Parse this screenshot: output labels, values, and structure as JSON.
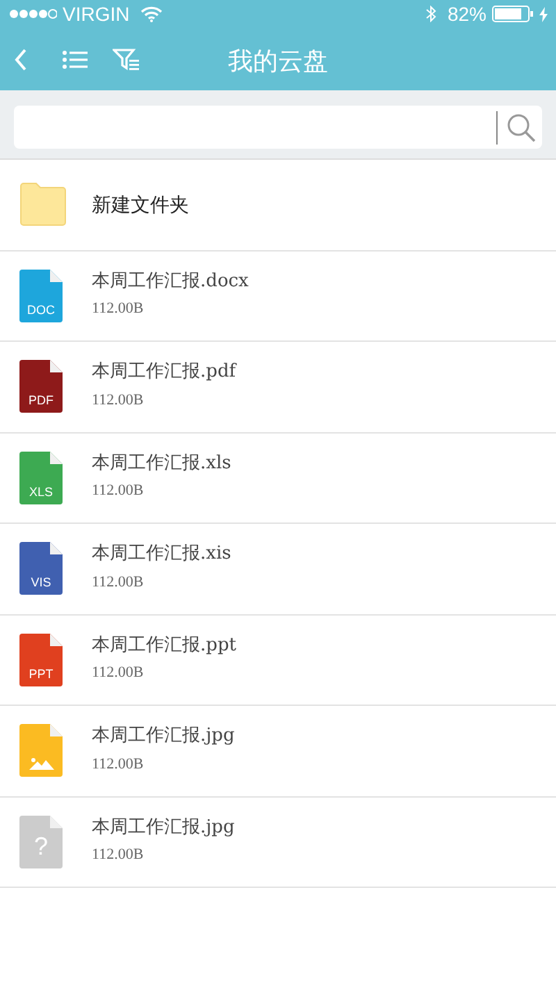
{
  "status_bar": {
    "carrier": "VIRGIN",
    "battery": "82%"
  },
  "header": {
    "title": "我的云盘"
  },
  "items": [
    {
      "kind": "folder",
      "name": "新建文件夹"
    },
    {
      "kind": "doc",
      "name": "本周工作汇报.docx",
      "size": "112.00B",
      "label": "DOC",
      "color": "#1ea6dc"
    },
    {
      "kind": "doc",
      "name": "本周工作汇报.pdf",
      "size": "112.00B",
      "label": "PDF",
      "color": "#8e1a1a"
    },
    {
      "kind": "doc",
      "name": "本周工作汇报.xls",
      "size": "112.00B",
      "label": "XLS",
      "color": "#3daa52"
    },
    {
      "kind": "doc",
      "name": "本周工作汇报.xis",
      "size": "112.00B",
      "label": "VIS",
      "color": "#4060b0"
    },
    {
      "kind": "doc",
      "name": "本周工作汇报.ppt",
      "size": "112.00B",
      "label": "PPT",
      "color": "#e0401f"
    },
    {
      "kind": "image",
      "name": "本周工作汇报.jpg",
      "size": "112.00B",
      "color": "#fbbb22"
    },
    {
      "kind": "unknown",
      "name": "本周工作汇报.jpg",
      "size": "112.00B",
      "label": "?",
      "color": "#cccccc"
    }
  ]
}
